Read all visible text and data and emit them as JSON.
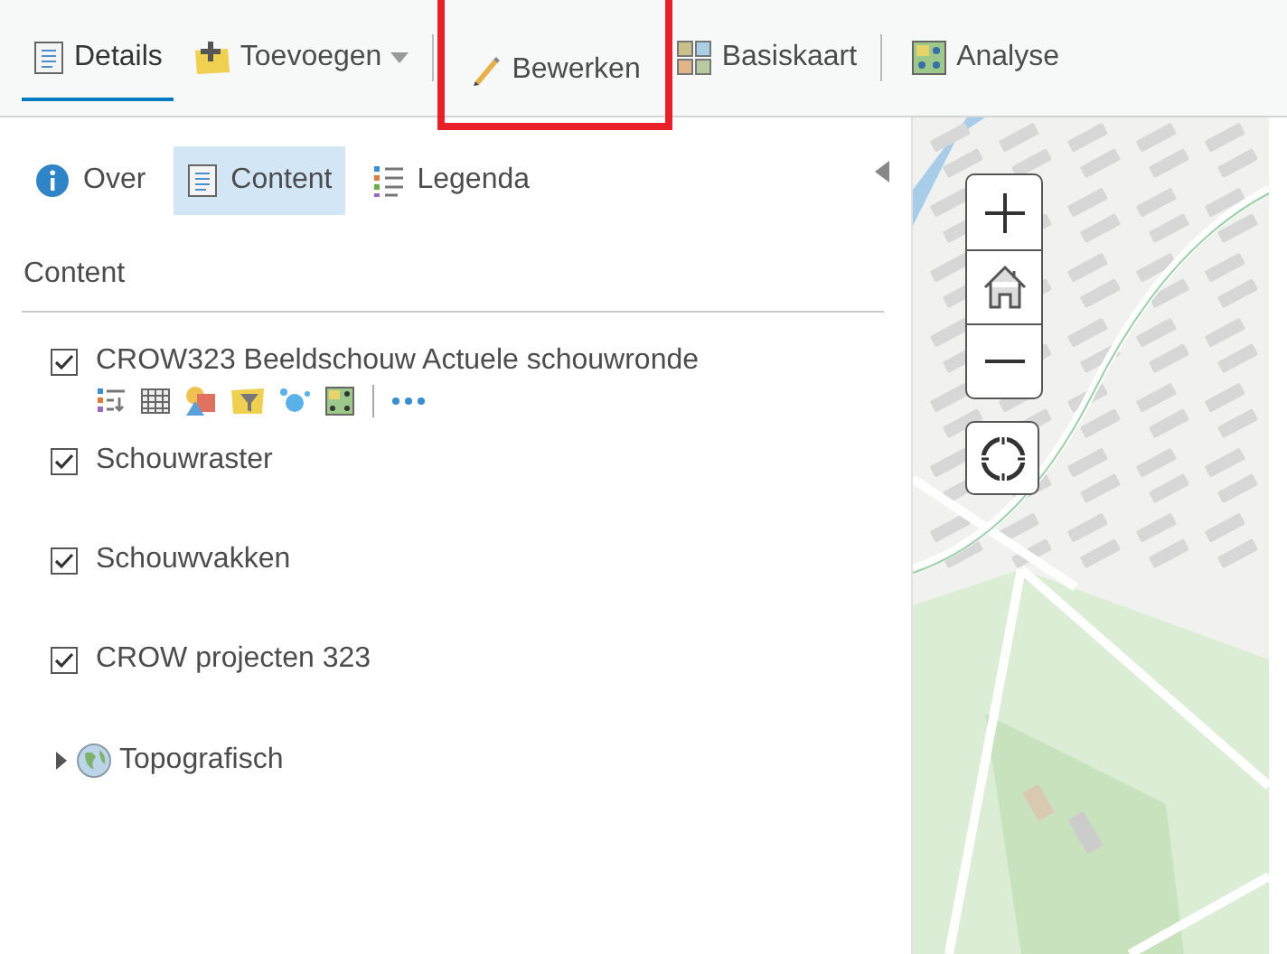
{
  "toolbar": {
    "items": [
      {
        "label": "Details",
        "selected": true,
        "dropdown": false,
        "separator_after": false,
        "highlighted": false
      },
      {
        "label": "Toevoegen",
        "selected": false,
        "dropdown": true,
        "separator_after": true,
        "highlighted": false
      },
      {
        "label": "Bewerken",
        "selected": false,
        "dropdown": false,
        "separator_after": false,
        "highlighted": true
      },
      {
        "label": "Basiskaart",
        "selected": false,
        "dropdown": false,
        "separator_after": true,
        "highlighted": false
      },
      {
        "label": "Analyse",
        "selected": false,
        "dropdown": false,
        "separator_after": false,
        "highlighted": false
      }
    ]
  },
  "tabs": [
    {
      "label": "Over",
      "selected": false
    },
    {
      "label": "Content",
      "selected": true
    },
    {
      "label": "Legenda",
      "selected": false
    }
  ],
  "content": {
    "title": "Content",
    "layers": [
      {
        "kind": "toollayer",
        "name": "CROW323 Beeldschouw Actuele schouwronde",
        "checked": true
      },
      {
        "kind": "layer",
        "name": "Schouwraster",
        "checked": true
      },
      {
        "kind": "layer",
        "name": "Schouwvakken",
        "checked": true
      },
      {
        "kind": "layer",
        "name": "CROW projecten 323",
        "checked": true
      },
      {
        "kind": "group",
        "name": "Topografisch",
        "expanded": false
      }
    ]
  }
}
